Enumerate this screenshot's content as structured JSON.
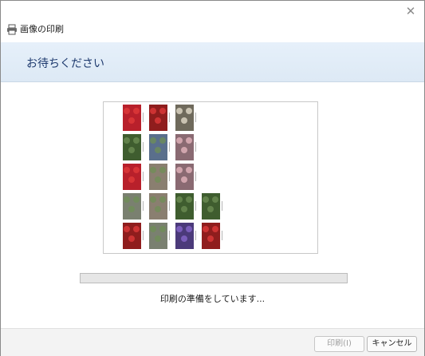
{
  "window": {
    "title": "画像の印刷",
    "title_icon": "printer-icon",
    "close_icon": "close-icon",
    "close_glyph": "✕"
  },
  "header": {
    "title": "お待ちください",
    "background": "#e3eef9",
    "title_color": "#1e3a6e"
  },
  "preview": {
    "thumbnails": [
      {
        "kind": "red-flower"
      },
      {
        "kind": "red-berries"
      },
      {
        "kind": "white-flower"
      },
      {
        "kind": "green-foliage"
      },
      {
        "kind": "blue-sky"
      },
      {
        "kind": "pink-flower"
      },
      {
        "kind": "red-flower"
      },
      {
        "kind": "bird"
      },
      {
        "kind": "pink-flower"
      },
      {
        "kind": "tree-sky"
      },
      {
        "kind": "bird"
      },
      {
        "kind": "green-foliage"
      },
      {
        "kind": "green-foliage"
      },
      {
        "kind": "red-berries"
      },
      {
        "kind": "tree-sky"
      },
      {
        "kind": "purple-flower"
      },
      {
        "kind": "red-berries"
      }
    ],
    "colors": {
      "red-flower": "#b8202b",
      "red-berries": "#8f1d1d",
      "white-flower": "#6f6a5c",
      "green-foliage": "#3f5d2f",
      "blue-sky": "#5a6f8c",
      "pink-flower": "#8a6a72",
      "bird": "#8a7f70",
      "tree-sky": "#7a8070",
      "purple-flower": "#4b3a7a"
    }
  },
  "progress": {
    "value": 0,
    "color": "#06b025"
  },
  "status": {
    "text": "印刷の準備をしています..."
  },
  "footer": {
    "print_label": "印刷(I)",
    "cancel_label": "キャンセル"
  }
}
